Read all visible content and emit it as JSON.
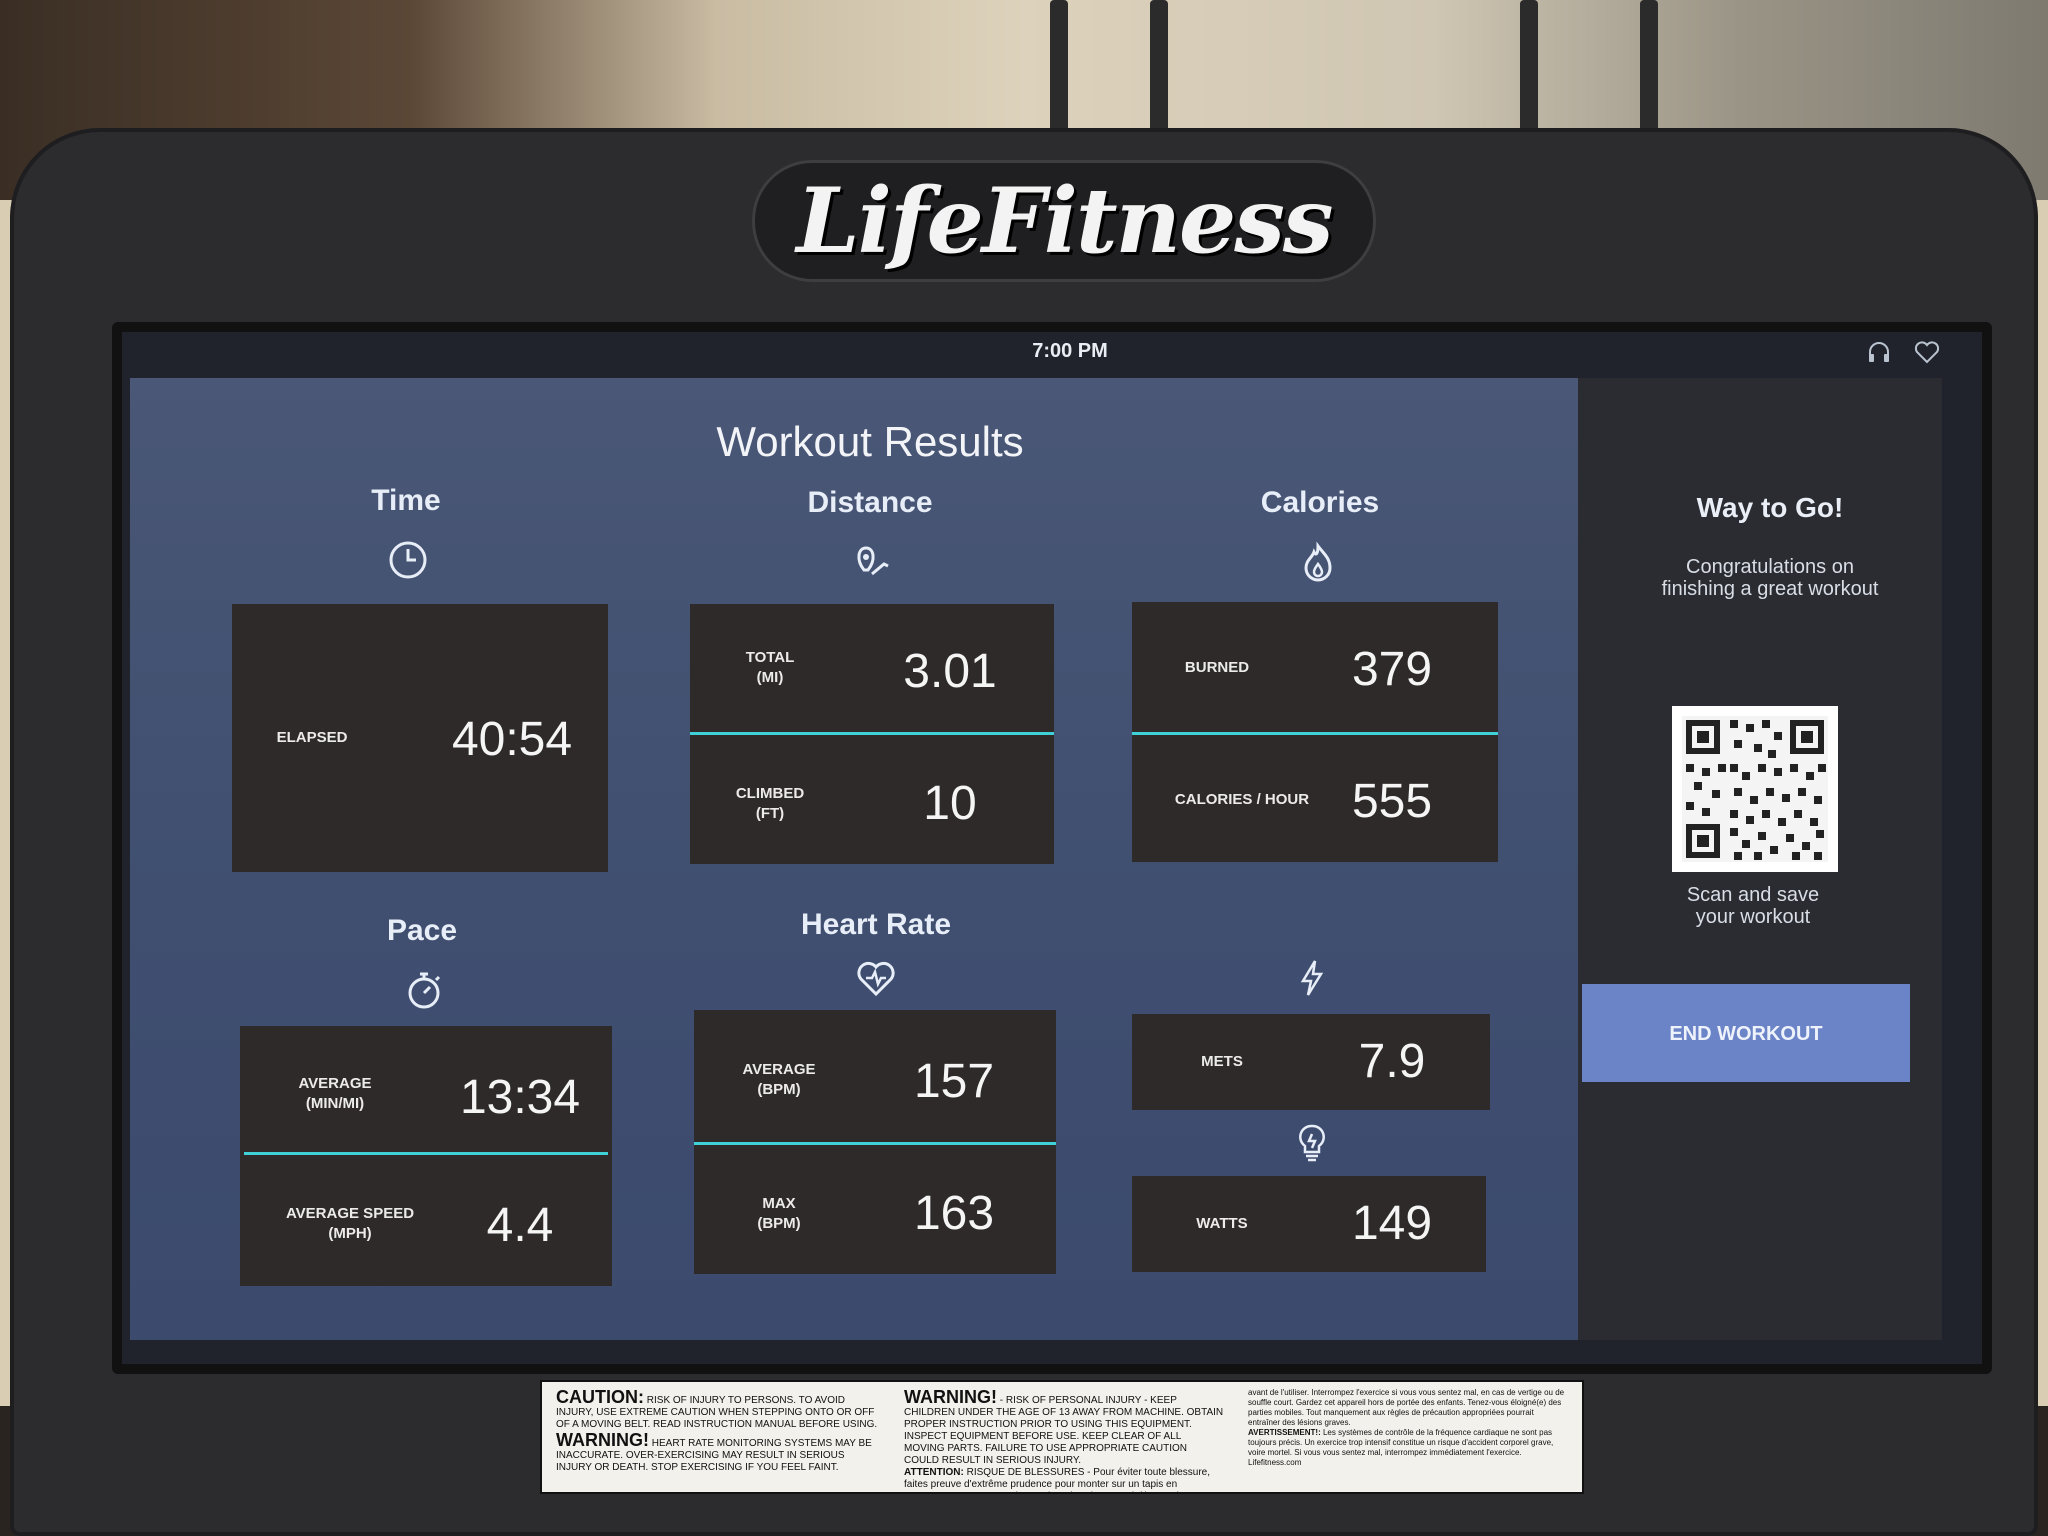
{
  "brand": {
    "logo_text": "LifeFitness"
  },
  "status": {
    "time": "7:00 PM",
    "icons": [
      "headphones-icon",
      "heart-icon"
    ]
  },
  "title": "Workout Results",
  "sections": {
    "time": {
      "title": "Time",
      "icon": "clock-icon",
      "stats": [
        {
          "label": "ELAPSED",
          "value": "40:54"
        }
      ]
    },
    "distance": {
      "title": "Distance",
      "icon": "location-pin-icon",
      "stats": [
        {
          "label": "TOTAL",
          "unit": "(MI)",
          "value": "3.01"
        },
        {
          "label": "CLIMBED",
          "unit": "(FT)",
          "value": "10"
        }
      ]
    },
    "calories": {
      "title": "Calories",
      "icon": "flame-icon",
      "stats": [
        {
          "label": "BURNED",
          "value": "379"
        },
        {
          "label": "CALORIES / HOUR",
          "value": "555"
        }
      ]
    },
    "pace": {
      "title": "Pace",
      "icon": "stopwatch-icon",
      "stats": [
        {
          "label": "AVERAGE",
          "unit": "(MIN/MI)",
          "value": "13:34"
        },
        {
          "label": "AVERAGE SPEED",
          "unit": "(MPH)",
          "value": "4.4"
        }
      ]
    },
    "heart_rate": {
      "title": "Heart Rate",
      "icon": "heart-pulse-icon",
      "stats": [
        {
          "label": "AVERAGE",
          "unit": "(BPM)",
          "value": "157"
        },
        {
          "label": "MAX",
          "unit": "(BPM)",
          "value": "163"
        }
      ]
    },
    "mets": {
      "icon": "lightning-icon",
      "label": "METS",
      "value": "7.9"
    },
    "watts": {
      "icon": "lightbulb-icon",
      "label": "WATTS",
      "value": "149"
    }
  },
  "sidebar": {
    "title": "Way to Go!",
    "subtitle_line1": "Congratulations on",
    "subtitle_line2": "finishing a great workout",
    "qr_line1": "Scan and save",
    "qr_line2": "your workout",
    "end_button": "END WORKOUT"
  },
  "warning_label": {
    "caution_head": "CAUTION:",
    "caution_text": "RISK OF INJURY TO PERSONS. TO AVOID INJURY, USE EXTREME CAUTION WHEN STEPPING ONTO OR OFF OF A MOVING BELT. READ INSTRUCTION MANUAL BEFORE USING.",
    "warning_head_1": "WARNING!",
    "warning_text_1": "HEART RATE MONITORING SYSTEMS MAY BE INACCURATE. OVER-EXERCISING MAY RESULT IN SERIOUS INJURY OR DEATH. STOP EXERCISING IF YOU FEEL FAINT.",
    "warning_head_2": "WARNING!",
    "warning_text_2": "- RISK OF PERSONAL INJURY - KEEP CHILDREN UNDER THE AGE OF 13 AWAY FROM MACHINE. OBTAIN PROPER INSTRUCTION PRIOR TO USING THIS EQUIPMENT. INSPECT EQUIPMENT BEFORE USE. KEEP CLEAR OF ALL MOVING PARTS. FAILURE TO USE APPROPRIATE CAUTION COULD RESULT IN SERIOUS INJURY.",
    "attention_head": "ATTENTION:",
    "attention_text": "RISQUE DE BLESSURES - Pour éviter toute blessure, faites preuve d'extrême prudence pour monter sur un tapis en mouvement, ou pour en descendre. Lisez le manuel d'instructions avant utilisation.",
    "french_text": "avant de l'utiliser. Interrompez l'exercice si vous vous sentez mal, en cas de vertige ou de souffle court. Gardez cet appareil hors de portée des enfants. Tenez-vous éloigné(e) des parties mobiles. Tout manquement aux règles de précaution appropriées pourrait entraîner des lésions graves.",
    "avert_head": "AVERTISSEMENT!:",
    "avert_text": "Les systèmes de contrôle de la fréquence cardiaque ne sont pas toujours précis. Un exercice trop intensif constitue un risque d'accident corporel grave, voire mortel. Si vous vous sentez mal, interrompez immédiatement l'exercice.",
    "site": "Lifefitness.com"
  },
  "colors": {
    "panel": "#415071",
    "card": "#2e2a2a",
    "accent": "#3fd0d8",
    "button": "#6b83c7"
  }
}
